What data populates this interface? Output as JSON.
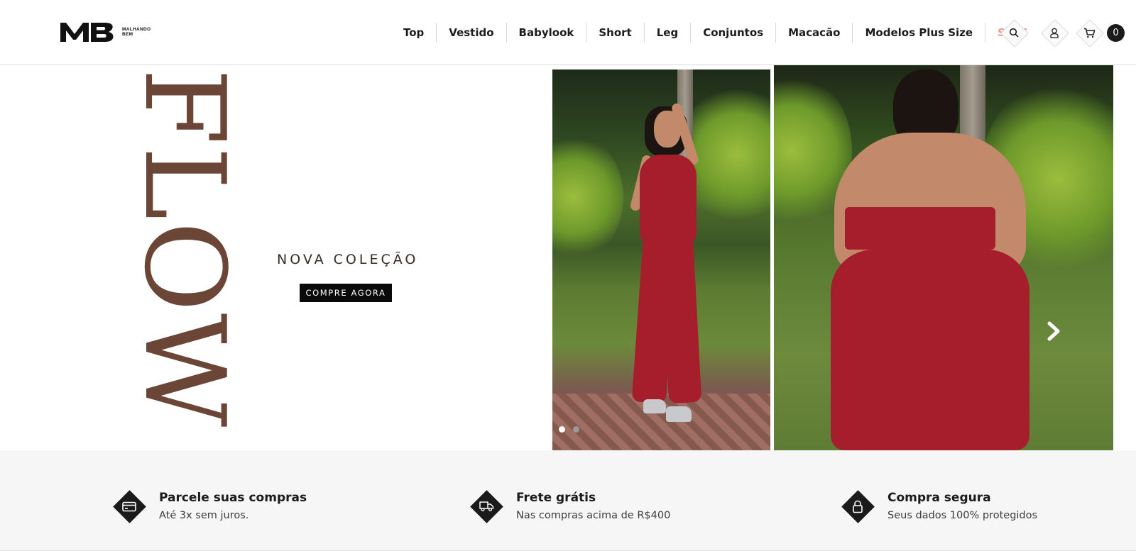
{
  "header": {
    "logo_text": "MB",
    "logo_sub_line1": "MALHANDO",
    "logo_sub_line2": "BEM",
    "nav": [
      {
        "label": "Top"
      },
      {
        "label": "Vestido"
      },
      {
        "label": "Babylook"
      },
      {
        "label": "Short"
      },
      {
        "label": "Leg"
      },
      {
        "label": "Conjuntos"
      },
      {
        "label": "Macacão"
      },
      {
        "label": "Modelos Plus Size"
      },
      {
        "label": "SALE"
      }
    ],
    "icons": [
      "search-icon",
      "user-icon",
      "cart-icon"
    ],
    "cart_count": "0",
    "sale_color": "#e89b96"
  },
  "hero": {
    "vertical_word": "FLOW",
    "tagline": "NOVA COLEÇÃO",
    "cta_label": "COMPRE AGORA",
    "accent_color": "#6b4535",
    "slides_total": 2,
    "active_slide": 1
  },
  "benefits": [
    {
      "icon": "credit-card-icon",
      "title": "Parcele suas compras",
      "subtitle": "Até 3x sem juros."
    },
    {
      "icon": "truck-icon",
      "title": "Frete grátis",
      "subtitle": "Nas compras acima de R$400"
    },
    {
      "icon": "lock-icon",
      "title": "Compra segura",
      "subtitle": "Seus dados 100% protegidos"
    }
  ]
}
